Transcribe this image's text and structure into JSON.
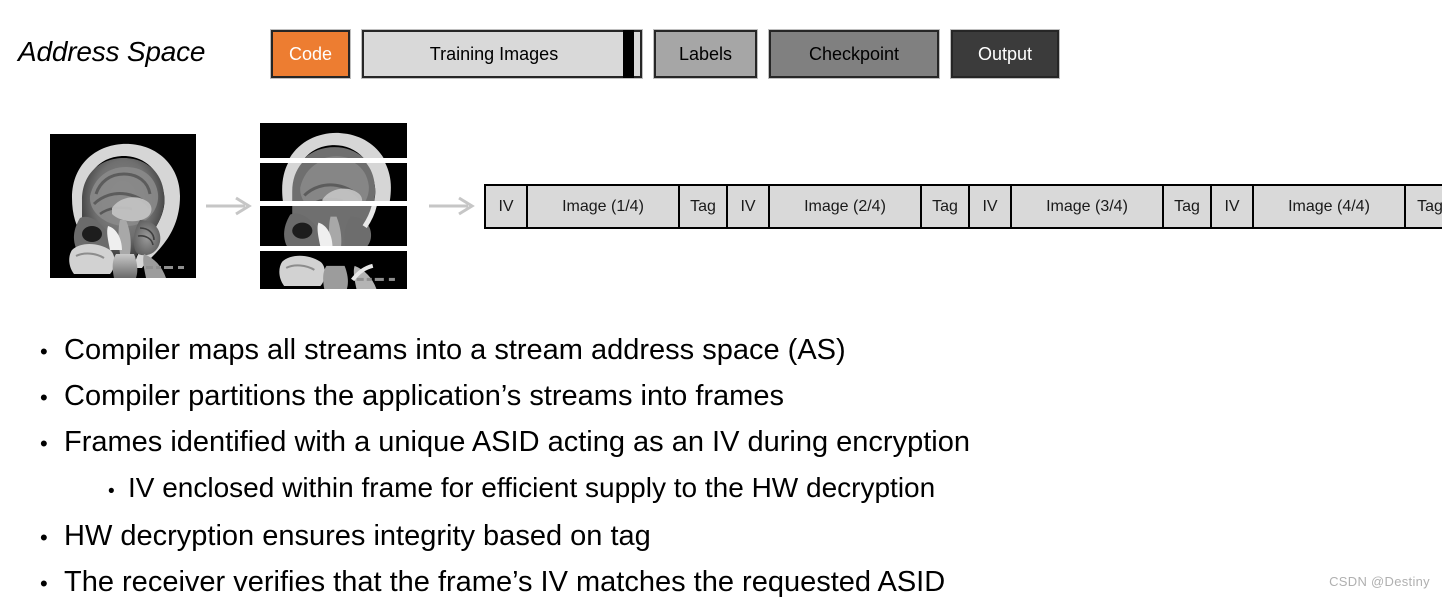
{
  "slide": {
    "address_space_label": "Address Space"
  },
  "address_space": {
    "blocks": [
      {
        "label": "Code",
        "color": "#ed7d31"
      },
      {
        "label": "Training Images",
        "color": "#d9d9d9"
      },
      {
        "label": "Labels",
        "color": "#a6a6a6"
      },
      {
        "label": "Checkpoint",
        "color": "#808080"
      },
      {
        "label": "Output",
        "color": "#3b3b3b"
      }
    ]
  },
  "pipeline": {
    "source_image_alt": "sagittal-brain-mri",
    "slice_count": 4,
    "arrow_1": "arrow-right-icon",
    "arrow_2": "arrow-right-icon"
  },
  "frames": {
    "cells": [
      {
        "label": "IV",
        "kind": "iv"
      },
      {
        "label": "Image (1/4)",
        "kind": "img"
      },
      {
        "label": "Tag",
        "kind": "tag"
      },
      {
        "label": "IV",
        "kind": "iv"
      },
      {
        "label": "Image (2/4)",
        "kind": "img"
      },
      {
        "label": "Tag",
        "kind": "tag"
      },
      {
        "label": "IV",
        "kind": "iv"
      },
      {
        "label": "Image (3/4)",
        "kind": "img"
      },
      {
        "label": "Tag",
        "kind": "tag"
      },
      {
        "label": "IV",
        "kind": "iv"
      },
      {
        "label": "Image (4/4)",
        "kind": "img"
      },
      {
        "label": "Tag",
        "kind": "tag"
      }
    ]
  },
  "bullets": [
    {
      "level": 1,
      "marker": "•",
      "text": "Compiler maps all streams into a stream address space (AS)"
    },
    {
      "level": 1,
      "marker": "•",
      "text": "Compiler partitions the application’s streams into frames"
    },
    {
      "level": 1,
      "marker": "•",
      "text": "Frames identified with a unique ASID acting as an IV during encryption"
    },
    {
      "level": 2,
      "marker": "•",
      "text": "IV enclosed within frame for efficient supply to the HW decryption"
    },
    {
      "level": 1,
      "marker": "•",
      "text": "HW decryption ensures integrity based on tag"
    },
    {
      "level": 1,
      "marker": "•",
      "text": "The receiver verifies that the frame’s IV matches the requested ASID"
    }
  ],
  "watermark": {
    "text": "CSDN @Destiny"
  }
}
